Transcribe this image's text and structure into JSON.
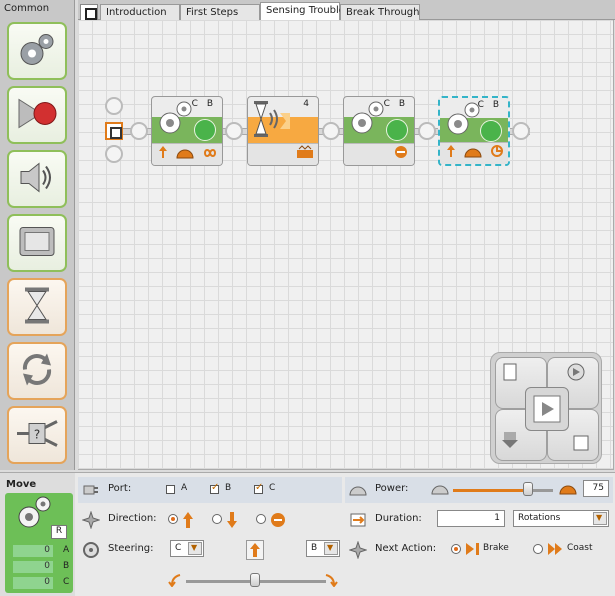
{
  "palette": {
    "title": "Common",
    "items": [
      {
        "icon": "move-gears-icon"
      },
      {
        "icon": "record-play-icon"
      },
      {
        "icon": "sound-icon"
      },
      {
        "icon": "display-icon"
      },
      {
        "icon": "wait-hourglass-icon"
      },
      {
        "icon": "loop-icon"
      },
      {
        "icon": "switch-icon"
      }
    ]
  },
  "tabs": [
    {
      "label": "Introduction"
    },
    {
      "label": "First Steps"
    },
    {
      "label": "Sensing Trouble",
      "active": true
    },
    {
      "label": "Break Through"
    }
  ],
  "canvas": {
    "blocks": [
      {
        "type": "move",
        "ports": "C B",
        "icons": [
          "forward-arrow-icon",
          "power-dial-icon",
          "unlimited-icon"
        ]
      },
      {
        "type": "wait",
        "ports": "4",
        "icons": [
          "sensor-threshold-icon"
        ]
      },
      {
        "type": "move",
        "ports": "C B",
        "icons": [
          "stop-icon"
        ]
      },
      {
        "type": "move",
        "ports": "C B",
        "selected": true,
        "icons": [
          "forward-arrow-icon",
          "power-dial-icon",
          "rotation-icon"
        ]
      }
    ]
  },
  "config": {
    "block_title": "Move",
    "feedback": {
      "badge": "R",
      "rows": [
        {
          "value": "0",
          "label": "A"
        },
        {
          "value": "0",
          "label": "B"
        },
        {
          "value": "0",
          "label": "C"
        }
      ]
    },
    "port": {
      "label": "Port:",
      "options": [
        "A",
        "B",
        "C"
      ],
      "checked": [
        false,
        true,
        true
      ]
    },
    "direction": {
      "label": "Direction:",
      "selected": 0
    },
    "steering": {
      "label": "Steering:",
      "left_port": "C",
      "right_port": "B"
    },
    "power": {
      "label": "Power:",
      "value": "75",
      "level_percent": 75
    },
    "duration": {
      "label": "Duration:",
      "value": "1",
      "unit": "Rotations"
    },
    "next_action": {
      "label": "Next Action:",
      "brake": "Brake",
      "coast": "Coast",
      "selected": "brake"
    }
  },
  "colors": {
    "accent": "#e07b1a",
    "move_green": "#7ab55c",
    "wait_orange": "#f7a941",
    "selection": "#34b4c8"
  }
}
